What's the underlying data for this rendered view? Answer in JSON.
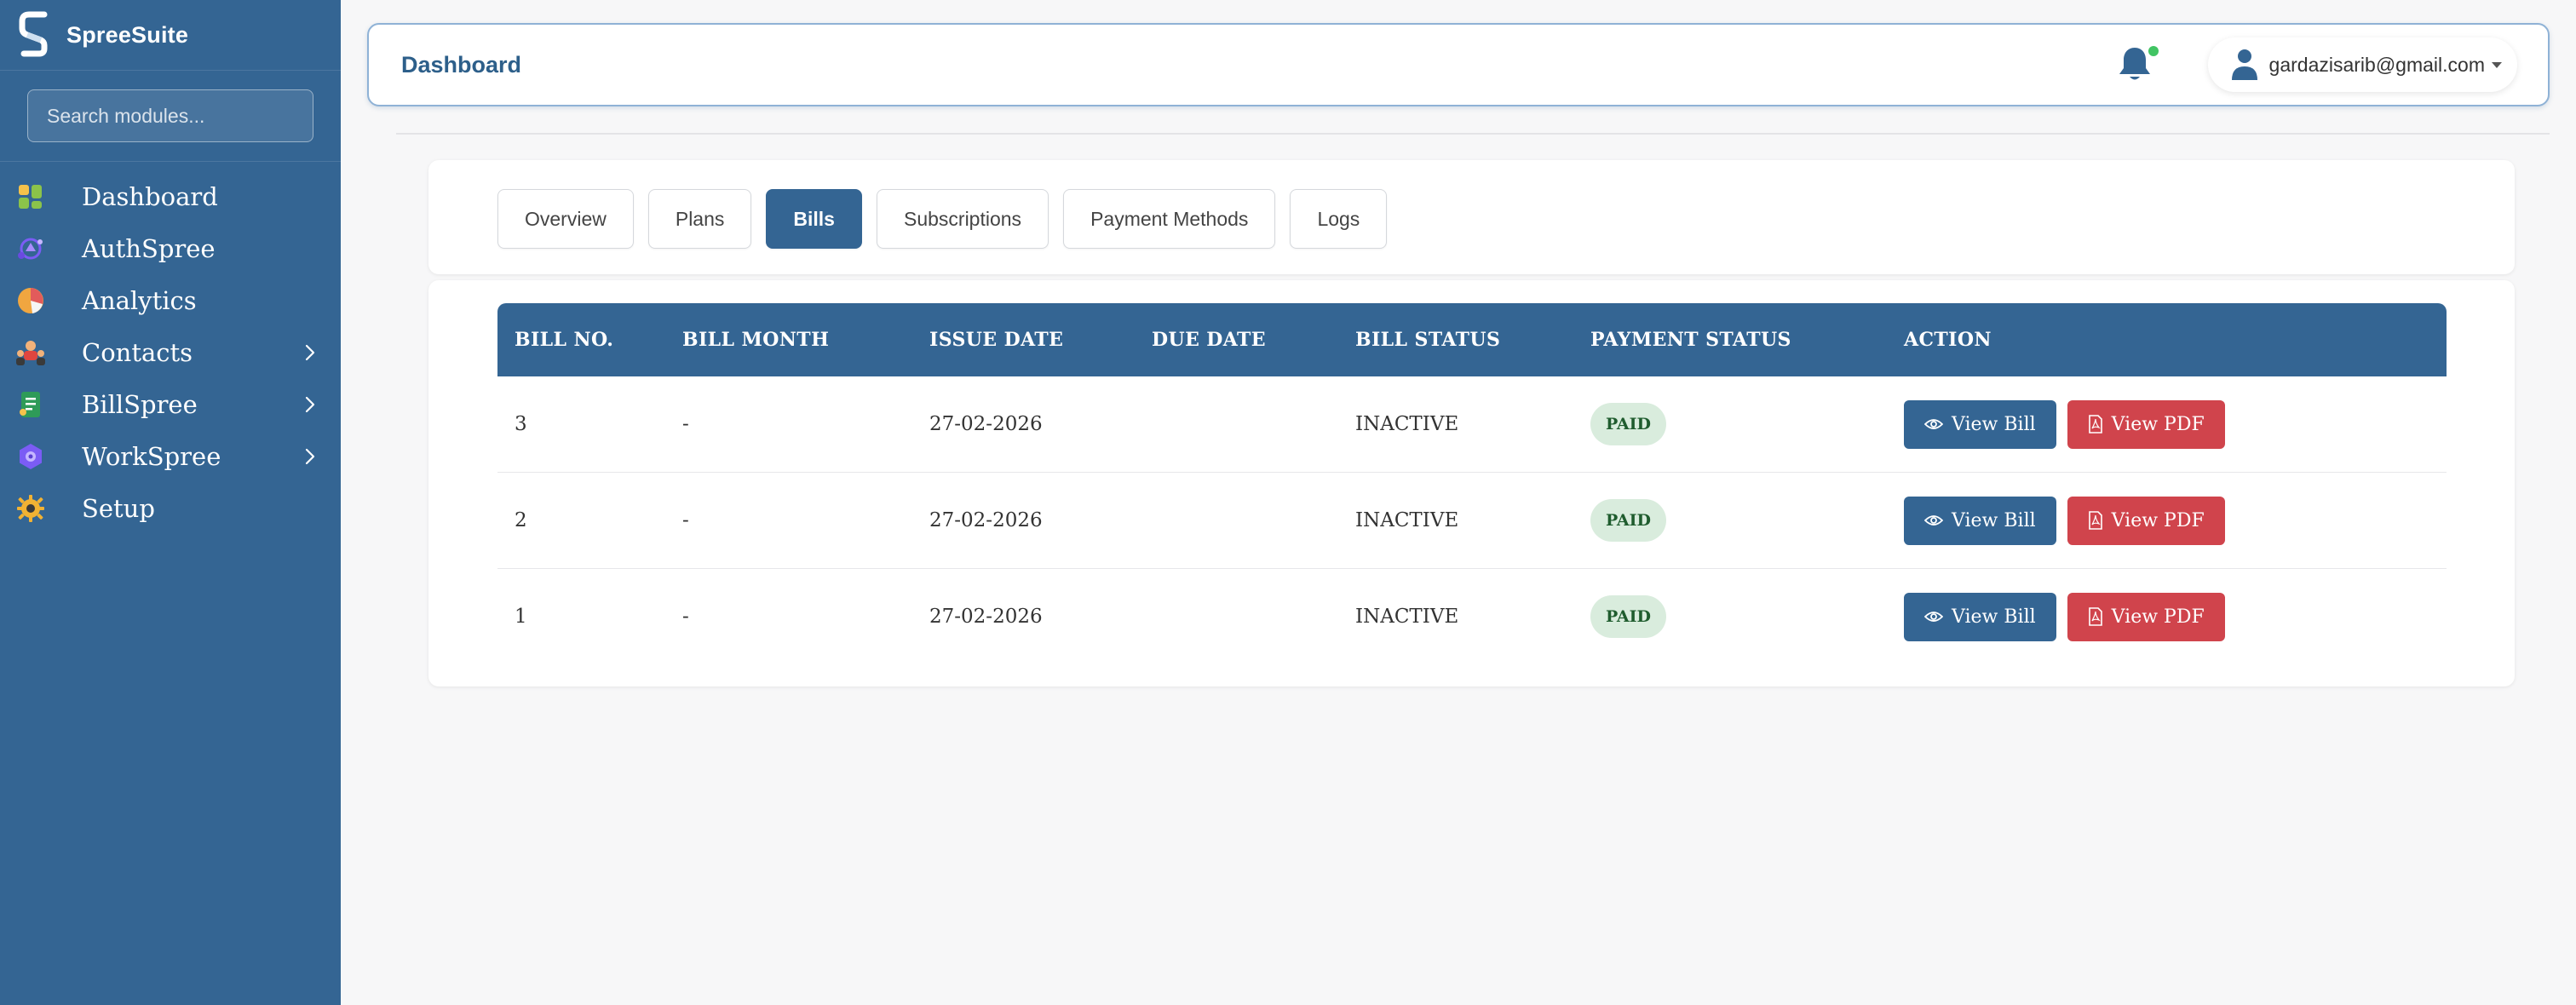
{
  "brand": {
    "name": "SpreeSuite"
  },
  "search": {
    "placeholder": "Search modules..."
  },
  "sidebar": {
    "items": [
      {
        "label": "Dashboard",
        "icon": "dashboard-grid-icon",
        "has_submenu": false
      },
      {
        "label": "AuthSpree",
        "icon": "authspree-icon",
        "has_submenu": false
      },
      {
        "label": "Analytics",
        "icon": "pie-chart-icon",
        "has_submenu": false
      },
      {
        "label": "Contacts",
        "icon": "contacts-icon",
        "has_submenu": true
      },
      {
        "label": "BillSpree",
        "icon": "bill-document-icon",
        "has_submenu": true
      },
      {
        "label": "WorkSpree",
        "icon": "workspree-icon",
        "has_submenu": true
      },
      {
        "label": "Setup",
        "icon": "gear-icon",
        "has_submenu": false
      }
    ]
  },
  "header": {
    "title": "Dashboard",
    "notification_status_color": "#41c463",
    "user_email": "gardazisarib@gmail.com"
  },
  "tabs": [
    {
      "label": "Overview",
      "active": false
    },
    {
      "label": "Plans",
      "active": false
    },
    {
      "label": "Bills",
      "active": true
    },
    {
      "label": "Subscriptions",
      "active": false
    },
    {
      "label": "Payment Methods",
      "active": false
    },
    {
      "label": "Logs",
      "active": false
    }
  ],
  "table": {
    "columns": [
      "BILL NO.",
      "BILL MONTH",
      "ISSUE DATE",
      "DUE DATE",
      "BILL STATUS",
      "PAYMENT STATUS",
      "ACTION"
    ],
    "rows": [
      {
        "bill_no": "3",
        "bill_month": "-",
        "issue_date": "27-02-2026",
        "due_date": "",
        "bill_status": "INACTIVE",
        "payment_status": "PAID"
      },
      {
        "bill_no": "2",
        "bill_month": "-",
        "issue_date": "27-02-2026",
        "due_date": "",
        "bill_status": "INACTIVE",
        "payment_status": "PAID"
      },
      {
        "bill_no": "1",
        "bill_month": "-",
        "issue_date": "27-02-2026",
        "due_date": "",
        "bill_status": "INACTIVE",
        "payment_status": "PAID"
      }
    ],
    "actions": {
      "view_bill": "View Bill",
      "view_pdf": "View PDF"
    }
  },
  "colors": {
    "primary": "#346593",
    "danger": "#d0444c",
    "paid_badge_bg": "#d9ecdd",
    "page_bg": "#f7f7f8"
  }
}
